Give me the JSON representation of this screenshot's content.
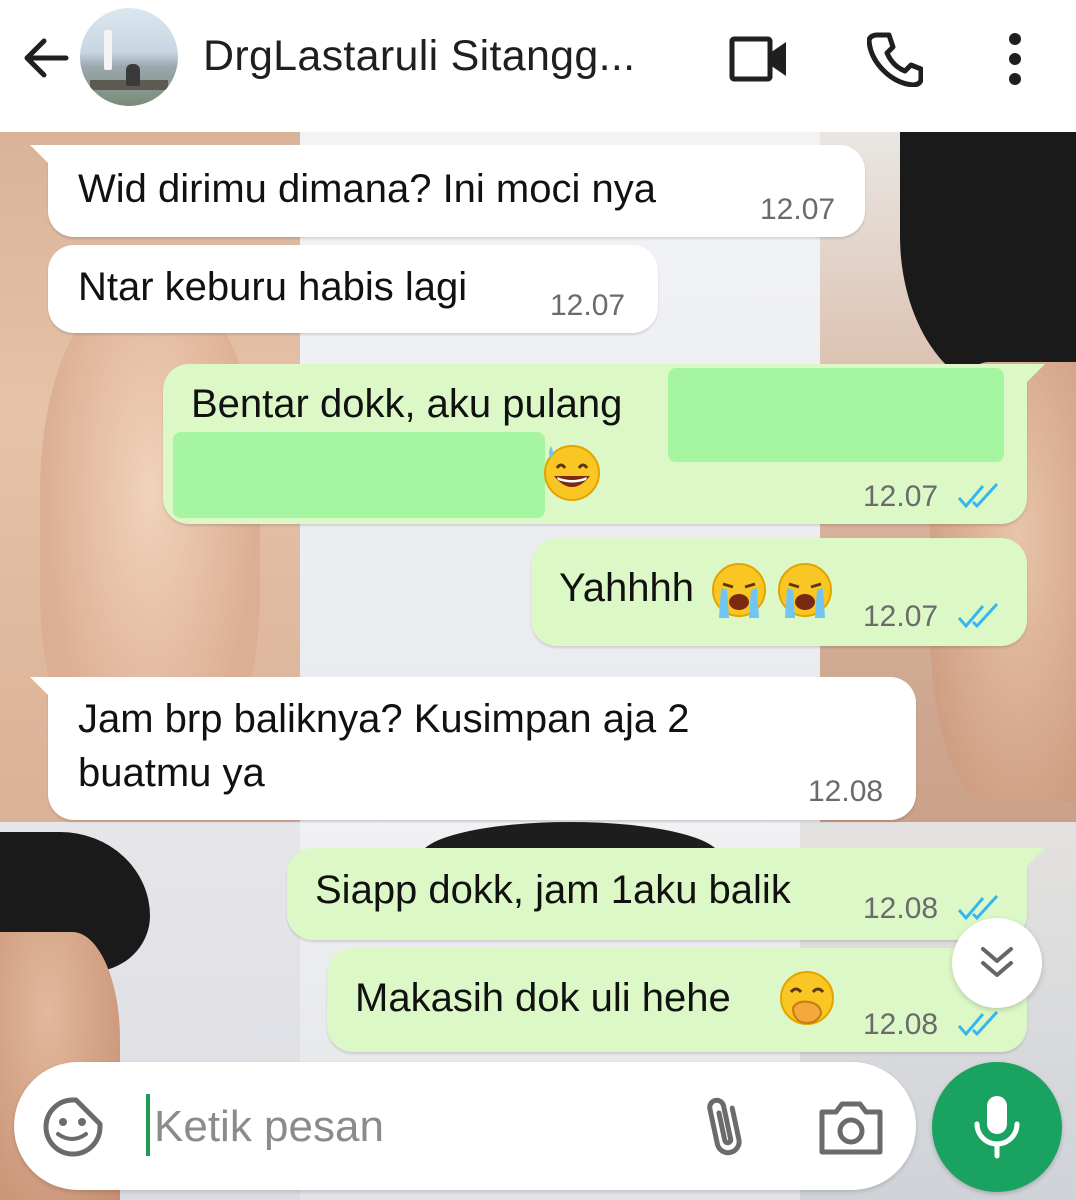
{
  "header": {
    "contact_name": "DrgLastaruli Sitangg...",
    "icons": [
      "back-arrow-icon",
      "video-call-icon",
      "voice-call-icon",
      "more-options-icon"
    ]
  },
  "messages": [
    {
      "direction": "incoming",
      "text": "Wid dirimu dimana? Ini moci nya",
      "time": "12.07"
    },
    {
      "direction": "incoming",
      "text": "Ntar keburu habis lagi",
      "time": "12.07"
    },
    {
      "direction": "outgoing",
      "text": "Bentar dokk, aku pulang",
      "emoji": "grinning-sweat-face",
      "time": "12.07",
      "status": "read",
      "redacted": true
    },
    {
      "direction": "outgoing",
      "text": "Yahhhh",
      "emoji": "loudly-crying-face x2",
      "time": "12.07",
      "status": "read"
    },
    {
      "direction": "incoming",
      "text_line1": "Jam brp baliknya? Kusimpan aja 2",
      "text_line2": "buatmu ya",
      "time": "12.08"
    },
    {
      "direction": "outgoing",
      "text": "Siapp dokk, jam 1aku balik",
      "time": "12.08",
      "status": "read"
    },
    {
      "direction": "outgoing",
      "text": "Makasih dok uli hehe",
      "emoji": "face-with-hand-over-mouth",
      "time": "12.08",
      "status": "read"
    }
  ],
  "composer": {
    "placeholder": "Ketik pesan",
    "icons": [
      "sticker-icon",
      "attach-icon",
      "camera-icon",
      "mic-icon"
    ]
  },
  "colors": {
    "outgoing_bubble": "#dcf8c6",
    "incoming_bubble": "#ffffff",
    "read_ticks": "#34b7f1",
    "mic_button": "#1aa260",
    "redaction": "#a6f5a0"
  }
}
